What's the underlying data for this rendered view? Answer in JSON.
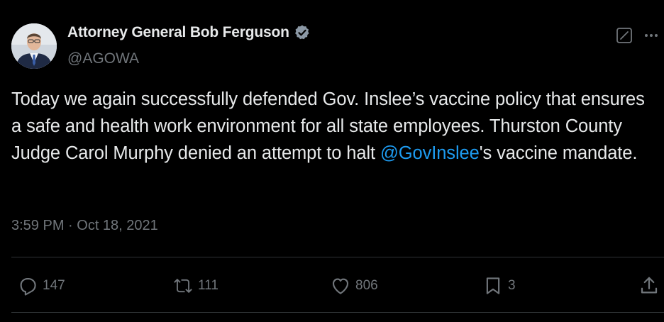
{
  "author": {
    "display_name": "Attorney General Bob Ferguson",
    "handle": "@AGOWA",
    "verified_badge": "verified-check-icon",
    "badge_color": "#8b98a5"
  },
  "tweet": {
    "text_before": "Today we again successfully defended Gov. Inslee’s vaccine policy that ensures a safe and health work environment for all state employees. Thurston County Judge Carol Murphy denied an attempt to halt ",
    "mention": "@GovInslee",
    "text_after": "'s vaccine mandate.",
    "time": "3:59 PM",
    "separator": " · ",
    "date": "Oct 18, 2021"
  },
  "actions": {
    "replies": "147",
    "reposts": "111",
    "likes": "806",
    "bookmarks": "3"
  },
  "colors": {
    "background": "#000000",
    "text": "#e7e9ea",
    "secondary": "#71767b",
    "link": "#1d9bf0",
    "divider": "#2f3336"
  }
}
